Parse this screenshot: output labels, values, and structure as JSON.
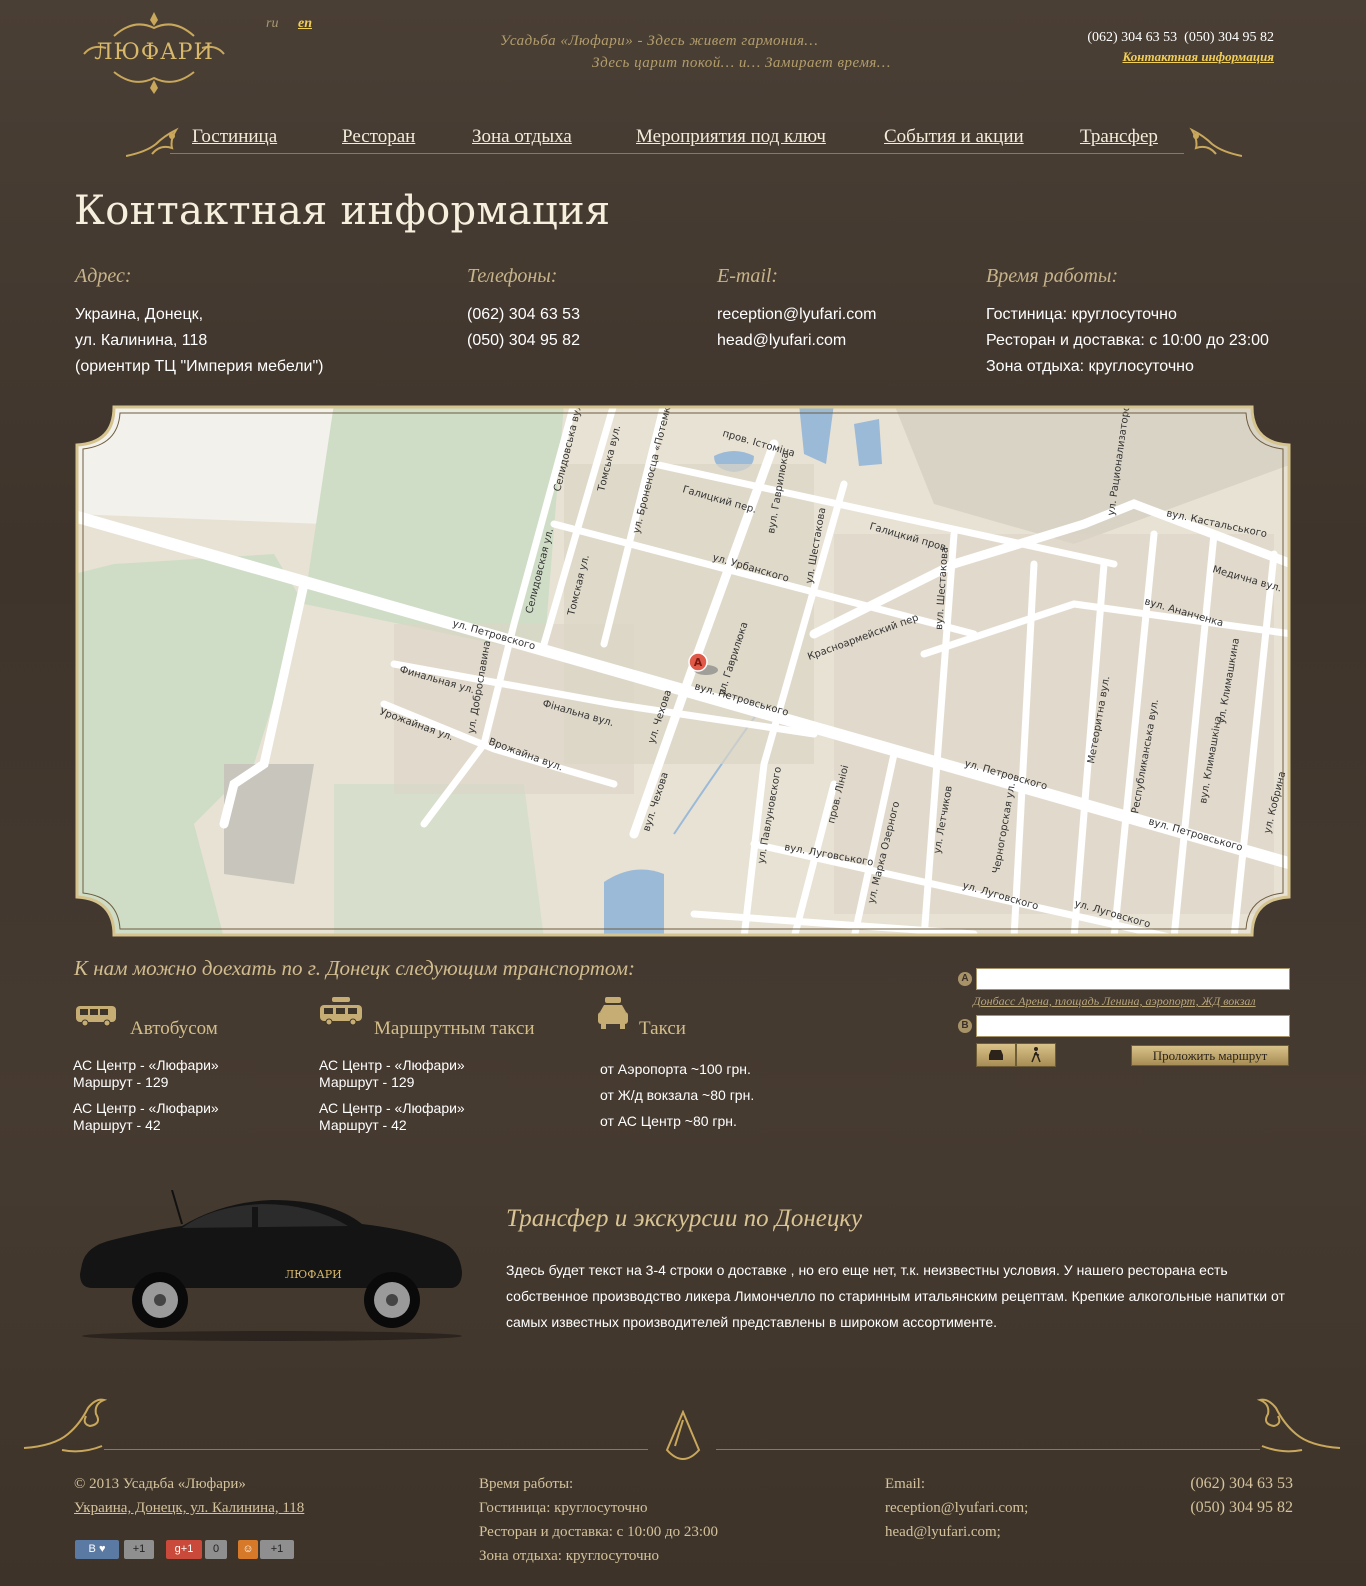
{
  "header": {
    "logo_text": "ЛЮФАРИ",
    "lang_ru": "ru",
    "lang_en": "en",
    "slogan_line1": "Усадьба «Люфари» - Здесь живет гармония…",
    "slogan_line2": "Здесь царит покой… и… Замирает время…",
    "phones": "(062) 304 63 53  (050) 304 95 82",
    "contact_link": "Контактная информация"
  },
  "nav": {
    "items": [
      "Гостиница",
      "Ресторан",
      "Зона отдыха",
      "Мероприятия под ключ",
      "События и акции",
      "Трансфер"
    ]
  },
  "page_title": "Контактная информация",
  "contacts": {
    "address_title": "Адрес:",
    "address_lines": [
      "Украина, Донецк,",
      "ул. Калинина, 118",
      "(ориентир ТЦ \"Империя мебели\")"
    ],
    "phones_title": "Телефоны:",
    "phones": [
      "(062) 304 63 53",
      "(050) 304 95 82"
    ],
    "email_title": "E-mail:",
    "emails": [
      "reception@lyufari.com",
      "head@lyufari.com"
    ],
    "hours_title": "Время работы:",
    "hours": [
      "Гостиница: круглосуточно",
      "Ресторан и доставка: с 10:00 до 23:00",
      "Зона отдыха: круглосуточно"
    ]
  },
  "map": {
    "marker": "A",
    "street_labels": [
      "ул. Петровского",
      "вул. Петровського",
      "Финальная ул.",
      "Фінальна вул.",
      "Урожайная ул.",
      "Врожайна вул.",
      "ул. Доброславина",
      "ул. Чехова",
      "вул. Чехова",
      "ул. Гаврилюка",
      "вул. Гаврилюка",
      "Красноармейский пер",
      "ул. Урбанского",
      "Галицкий пер.",
      "Галицкий пров",
      "ул. Шестакова",
      "вул. Шестакова",
      "пров. Істоміна",
      "Селидовская ул.",
      "Томская ул.",
      "Томська вул.",
      "ул. Броненосца «Потемкин»",
      "Селидовська вул.",
      "ул. Рационализаторов",
      "вул. Кастальського",
      "Медична вул.",
      "вул. Ананченка",
      "Метеоритна вул.",
      "Республиканська вул.",
      "ул. Климашкина",
      "вул. Климашкіна",
      "ул. Кобрина",
      "вул. Петровського",
      "ул. Петровского",
      "вул. Луговського",
      "ул. Луговского",
      "ул. Летчиков",
      "Черногорская ул.",
      "ул. Марка Озерного",
      "пров. Лініоі",
      "ул. Павлуновского",
      "ул. Луговского"
    ]
  },
  "transport": {
    "heading": "К нам можно доехать по г. Донецк следующим транспортом:",
    "bus_title": "Автобусом",
    "bus_lines": [
      "АС Центр - «Люфари»",
      "Маршрут - 129",
      "АС Центр - «Люфари»",
      "Маршрут - 42"
    ],
    "minibus_title": "Маршрутным такси",
    "minibus_lines": [
      "АС Центр - «Люфари»",
      "Маршрут - 129",
      "АС Центр - «Люфари»",
      "Маршрут - 42"
    ],
    "taxi_title": "Такси",
    "taxi_lines": [
      "от Аэропорта ~100 грн.",
      "от Ж/д вокзала ~80 грн.",
      "от АС Центр ~80 грн."
    ]
  },
  "route": {
    "badge_a": "A",
    "badge_b": "B",
    "input_a_value": "",
    "input_b_value": "",
    "hint": "Донбасс Арена, площадь Ленина, аэропорт, ЖД вокзал",
    "build_button": "Проложить маршрут"
  },
  "transfer": {
    "car_logo": "ЛЮФАРИ",
    "heading": "Трансфер и экскурсии по Донецку",
    "text": "Здесь будет текст на 3-4 строки о доставке , но его еще нет, т.к. неизвестны условия. У нашего ресторана есть собственное производство ликера Лимончелло по старинным итальянским рецептам. Крепкие алкогольные напитки от самых известных производителей представлены в широком ассортименте."
  },
  "footer": {
    "copyright": "© 2013 Усадьба «Люфари»",
    "address_link": "Украина, Донецк, ул. Калинина, 118",
    "hours_title": "Время работы:",
    "hours_lines": [
      "Гостиница: круглосуточно",
      "Ресторан и доставка: с 10:00 до 23:00",
      "Зона отдыха: круглосуточно"
    ],
    "email_title": "Email:",
    "emails": [
      "reception@lyufari.com;",
      "head@lyufari.com;"
    ],
    "phones": [
      "(062) 304 63 53",
      "(050) 304 95 82"
    ],
    "social": {
      "vk_label": "В",
      "vk_count": "+1",
      "gplus_label": "g",
      "gplus_plus": "+1",
      "gplus_count": "0",
      "ok_count": "+1"
    }
  },
  "colors": {
    "background": "#463b31",
    "gold": "#c7b48a",
    "link_yellow": "#f2cf55",
    "map_land": "#e8e2d4",
    "map_water": "#9bbad8",
    "map_green": "#cfddc6"
  }
}
